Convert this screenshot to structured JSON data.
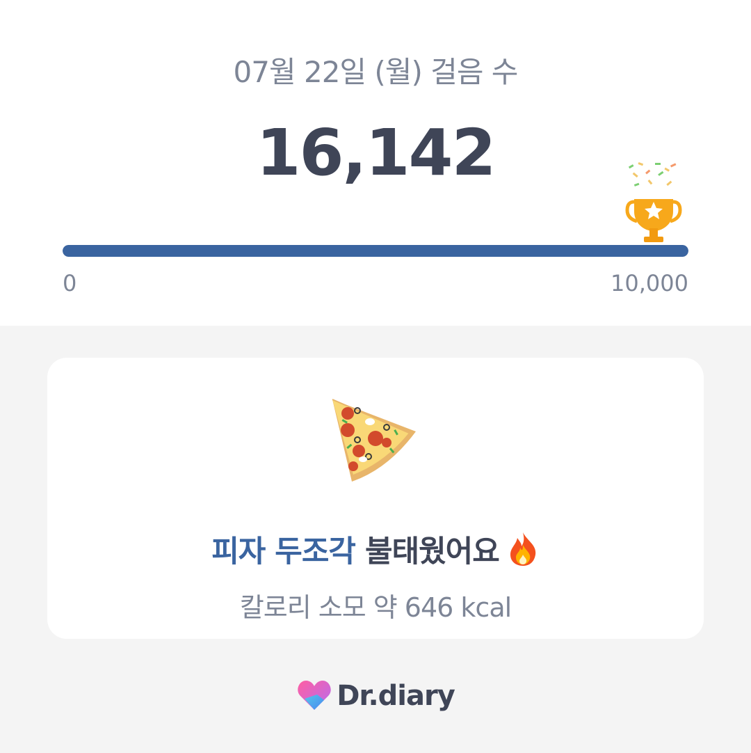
{
  "header": {
    "date_title": "07월 22일 (월) 걸음 수",
    "step_count": "16,142"
  },
  "progress": {
    "min_label": "0",
    "max_label": "10,000",
    "fraction": 1.0,
    "color": "#3a64a0"
  },
  "card": {
    "headline_accent": "피자 두조각",
    "headline_rest": "불태웠어요",
    "subline": "칼로리 소모 약 646 kcal",
    "food_icon": "pizza-slice",
    "emoji_icon": "fire"
  },
  "brand": {
    "name": "Dr.diary",
    "logo_icon": "heart-logo"
  },
  "colors": {
    "accent": "#3a64a0",
    "text_dark": "#3f4557",
    "text_muted": "#7d8596",
    "background": "#f4f4f4"
  }
}
